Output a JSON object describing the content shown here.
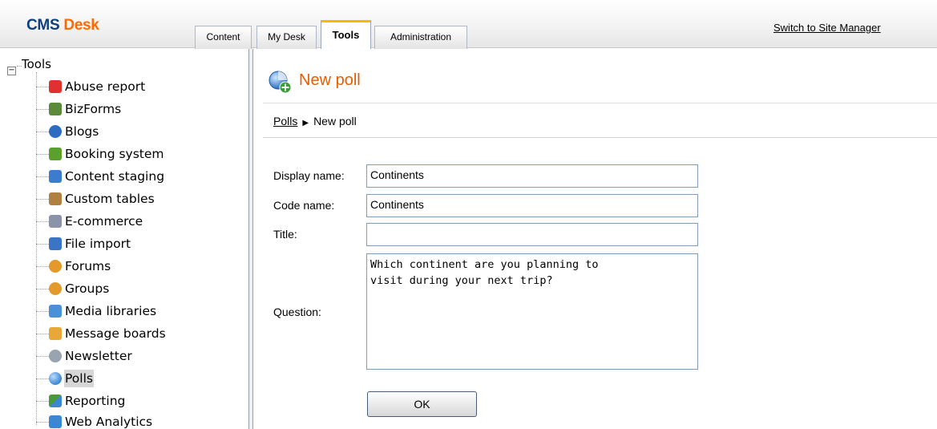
{
  "header": {
    "logo_cms": "CMS",
    "logo_desk": "Desk",
    "tabs": [
      {
        "label": "Content"
      },
      {
        "label": "My Desk"
      },
      {
        "label": "Tools"
      },
      {
        "label": "Administration"
      }
    ],
    "active_tab": "Tools",
    "switch_link": "Switch to Site Manager",
    "accent_color": "#ff6a00",
    "brand_color": "#0f3f7f"
  },
  "sidebar": {
    "root": {
      "expander": "−",
      "label": "Tools"
    },
    "items": [
      {
        "label": "Abuse report",
        "icon": "abuse-report-icon",
        "color": "#e03030"
      },
      {
        "label": "BizForms",
        "icon": "bizforms-icon",
        "color": "#5a8a3a"
      },
      {
        "label": "Blogs",
        "icon": "blogs-icon",
        "color": "#2d6cc0"
      },
      {
        "label": "Booking system",
        "icon": "booking-system-icon",
        "color": "#5aa02c"
      },
      {
        "label": "Content staging",
        "icon": "content-staging-icon",
        "color": "#3b7ccf"
      },
      {
        "label": "Custom tables",
        "icon": "custom-tables-icon",
        "color": "#b08040"
      },
      {
        "label": "E-commerce",
        "icon": "e-commerce-icon",
        "color": "#8a93a8"
      },
      {
        "label": "File import",
        "icon": "file-import-icon",
        "color": "#3a74c4"
      },
      {
        "label": "Forums",
        "icon": "forums-icon",
        "color": "#e39a2a"
      },
      {
        "label": "Groups",
        "icon": "groups-icon",
        "color": "#e39a2a"
      },
      {
        "label": "Media libraries",
        "icon": "media-libraries-icon",
        "color": "#4a90d9"
      },
      {
        "label": "Message boards",
        "icon": "message-boards-icon",
        "color": "#e8a838"
      },
      {
        "label": "Newsletter",
        "icon": "newsletter-icon",
        "color": "#9aa3b0"
      },
      {
        "label": "Polls",
        "icon": "polls-icon",
        "color": "#3d86d1"
      },
      {
        "label": "Reporting",
        "icon": "reporting-icon",
        "color": "#4a9a3a"
      },
      {
        "label": "Web Analytics",
        "icon": "web-analytics-icon",
        "color": "#3d86d1"
      }
    ],
    "selected": "Polls"
  },
  "main": {
    "title": "New poll",
    "title_icon": "new-poll-icon",
    "breadcrumb": {
      "link": "Polls",
      "separator": "▶",
      "current": "New poll"
    },
    "form": {
      "display_name_label": "Display name:",
      "display_name_value": "Continents",
      "code_name_label": "Code name:",
      "code_name_value": "Continents",
      "title_label": "Title:",
      "title_value": "",
      "question_label": "Question:",
      "question_value": "Which continent are you planning to\nvisit during your next trip?",
      "ok_label": "OK"
    }
  }
}
